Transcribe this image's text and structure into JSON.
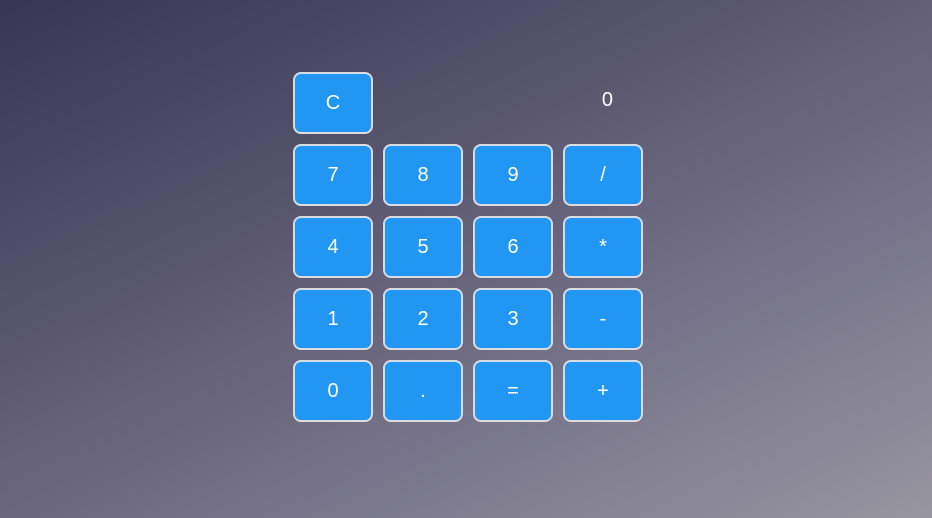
{
  "calculator": {
    "display_value": "0",
    "clear_label": "C",
    "keys": {
      "seven": "7",
      "eight": "8",
      "nine": "9",
      "divide": "/",
      "four": "4",
      "five": "5",
      "six": "6",
      "multiply": "*",
      "one": "1",
      "two": "2",
      "three": "3",
      "subtract": "-",
      "zero": "0",
      "decimal": ".",
      "equals": "=",
      "add": "+"
    }
  },
  "colors": {
    "button_bg": "#2196f3",
    "button_border": "#d9dce3",
    "text": "#ffffff",
    "background_start": "#373654",
    "background_end": "#97959f"
  }
}
